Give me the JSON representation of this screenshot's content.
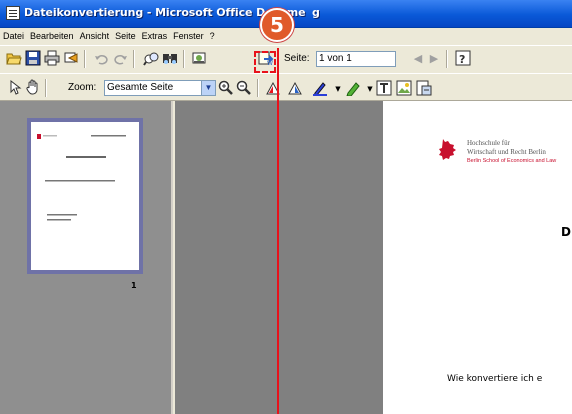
{
  "window": {
    "title": "Dateikonvertierung - Microsoft Office Docume",
    "title_tail": "g"
  },
  "menu": [
    "Datei",
    "Bearbeiten",
    "Ansicht",
    "Seite",
    "Extras",
    "Fenster",
    "?"
  ],
  "toolbar1": {
    "page_label": "Seite:",
    "page_value": "1 von 1"
  },
  "toolbar2": {
    "zoom_label": "Zoom:",
    "zoom_value": "Gesamte Seite"
  },
  "step_badge": "5",
  "thumbnail": {
    "page_number": "1"
  },
  "document": {
    "org_line1": "Hochschule für",
    "org_line2": "Wirtschaft und Recht Berlin",
    "org_line3": "Berlin School of Economics and Law",
    "heading_fragment": "D",
    "body_fragment": "Wie konvertiere ich e"
  },
  "colors": {
    "accent_red": "#e8121b",
    "badge": "#e05a2a",
    "thumb_border": "#6f72a7",
    "logo_red": "#c8102e"
  },
  "icons": [
    "app-icon",
    "open-icon",
    "save-icon",
    "print-icon",
    "email-icon",
    "undo-icon",
    "redo-icon",
    "find-text-icon",
    "search-icon",
    "read-aloud-icon",
    "make-convert-icon",
    "prev-page-icon",
    "next-page-icon",
    "help-icon",
    "select-pointer-icon",
    "hand-icon",
    "zoom-in-icon",
    "zoom-out-icon",
    "rotate-left-icon",
    "rotate-right-icon",
    "pen-icon",
    "highlighter-icon",
    "text-annotation-icon",
    "picture-icon",
    "page-image-icon",
    "bear-logo-icon"
  ]
}
